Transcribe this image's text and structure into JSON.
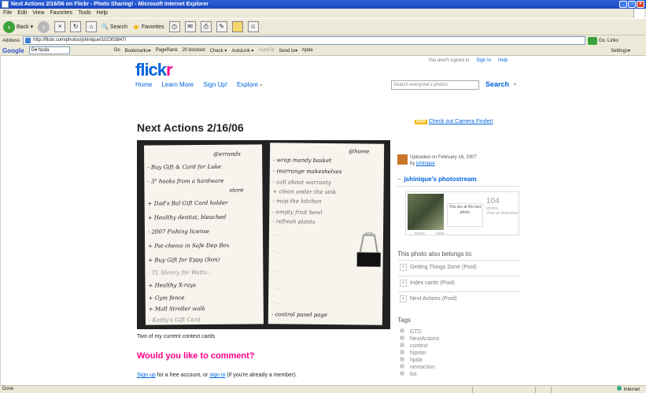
{
  "window": {
    "title": "Next Actions 2/16/06 on Flickr - Photo Sharing! - Microsoft Internet Explorer"
  },
  "menu": [
    "File",
    "Edit",
    "View",
    "Favorites",
    "Tools",
    "Help"
  ],
  "toolbar": {
    "back": "Back",
    "search": "Search",
    "favorites": "Favorites"
  },
  "address": {
    "label": "Address",
    "url": "http://flickr.com/photos/jshinique/102303847/",
    "go": "Go",
    "links": "Links"
  },
  "google": {
    "logo": "Google",
    "search_value": "G▾ hpda",
    "items": [
      "Go",
      "Bookmarks▾",
      "PageRank",
      "20 blocked",
      "Check ▾",
      "AutoLink ▾",
      "AutoFill",
      "Send to▾",
      "hpda"
    ],
    "settings": "Settings▾"
  },
  "page": {
    "logo_a": "flick",
    "logo_b": "r",
    "nav": [
      "Home",
      "Learn More",
      "Sign Up!",
      "Explore"
    ],
    "explore_arrow": "▾",
    "user_text": "You aren't signed in",
    "sign_in": "Sign In",
    "help": "Help",
    "search_placeholder": "Search everyone's photos",
    "search_button": "Search",
    "search_arrow": "▾",
    "photo_title": "Next Actions 2/16/06",
    "caption": "Two of my current context cards",
    "comment_heading": "Would you like to comment?",
    "signup_link": "Sign up",
    "signup_mid": " for a free account, or ",
    "signin_link": "sign in",
    "signup_tail": " (if you're already a member)."
  },
  "photo_notes": {
    "left": [
      "@errands",
      "- Buy Gift & Card for Luke",
      "- 3\" hooks from a hardware",
      "store",
      "+ Dad's Bal Gift Card holder",
      "+ Healthy dentist, bleached",
      "- 2007 Fishing license",
      "+ Pat-chems in Safe Dep Box",
      "+ Buy Gift for Eppy (Son)",
      "- TL library for Watts..",
      "+ Healthy X-rays",
      "+ Gym fence",
      "+ Mall Stroller walk",
      "- Kathy's Gift Card"
    ],
    "right": [
      "@home",
      "- wrap mandy basket",
      "- rearrange makeshelves",
      "- call about warranty",
      "+ clean under the sink",
      "- mop the kitchen",
      "- empty fruit bowl",
      "- refresh plants",
      "- ...",
      "- ...",
      "- ...",
      "- ...",
      "- ...",
      "- control panel page"
    ]
  },
  "sidebar": {
    "new_badge": "NEW",
    "camera_finder": "Check out Camera Finder!",
    "uploaded_text": "Uploaded on February 16, 2007",
    "by": "by ",
    "author": "jshinique",
    "photostream_dash": "–",
    "photostream": "jshinique's photostream",
    "you_are_at": "You are at the last photo",
    "count": "104",
    "count_label": "photos",
    "view_as": "View as slideshow",
    "nav_prev": "← newer",
    "nav_next": "older →",
    "belongs": "This photo also belongs to:",
    "pools": [
      "Getting Things Done (Pool)",
      "Index cards (Pool)",
      "Next Actions (Pool)"
    ],
    "tags_head": "Tags",
    "tags": [
      "GTD",
      "NextActions",
      "context",
      "hipster",
      "hpda",
      "nextaction",
      "list"
    ]
  },
  "status": {
    "text": "Done",
    "zone": "Internet"
  }
}
